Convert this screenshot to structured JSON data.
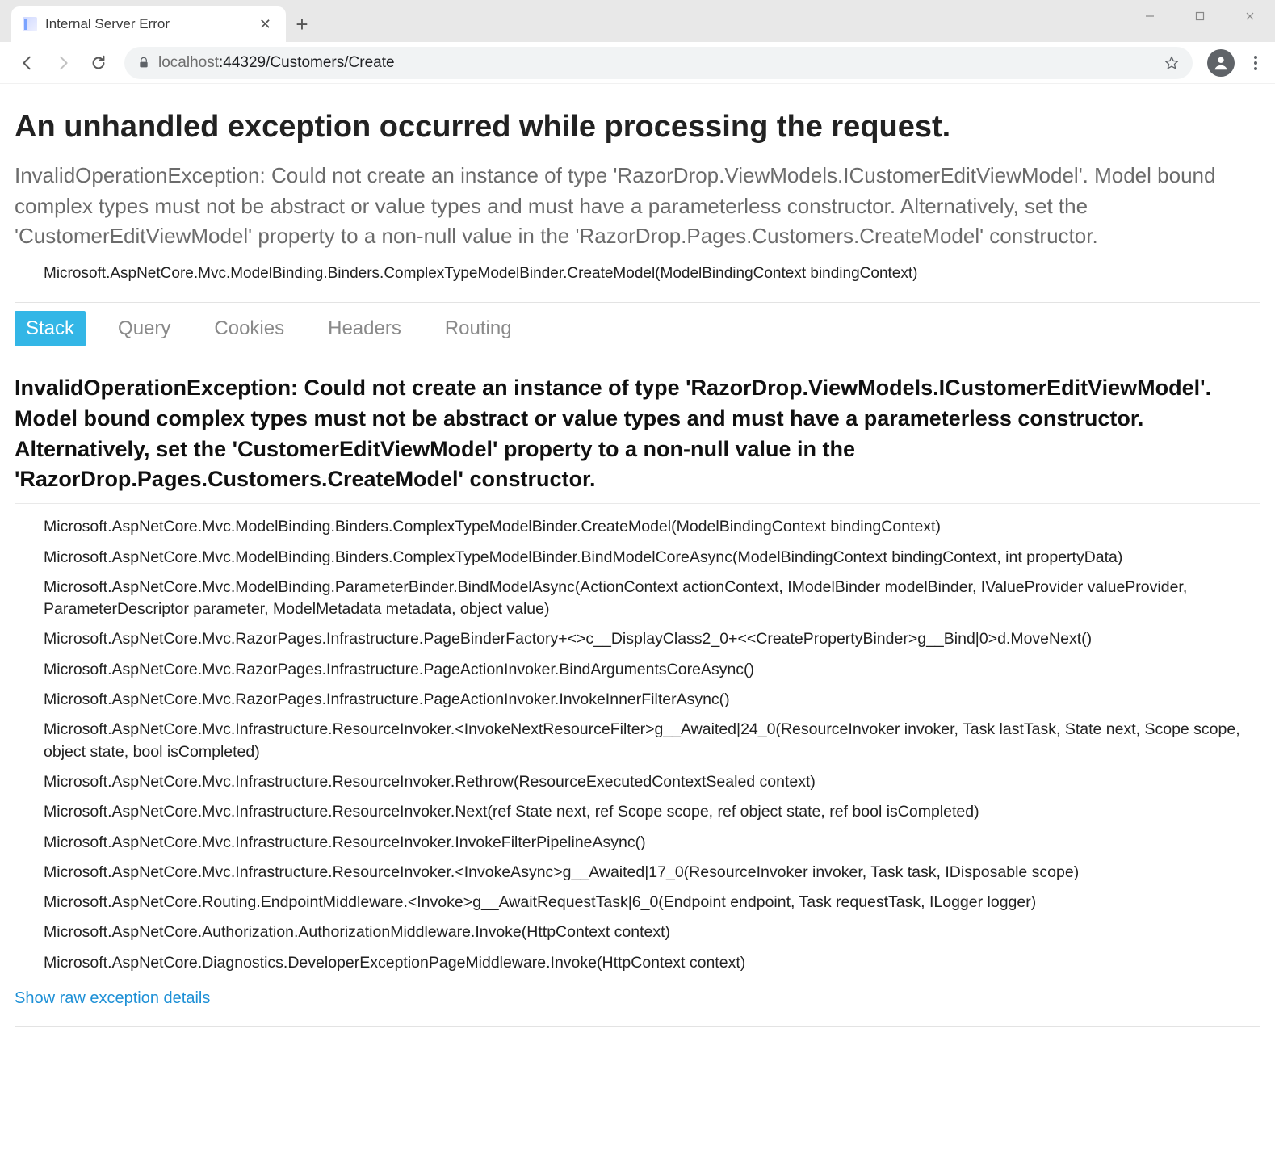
{
  "window": {
    "tab_title": "Internal Server Error",
    "url_host_muted": "localhost",
    "url_port_path": ":44329/Customers/Create"
  },
  "error": {
    "title": "An unhandled exception occurred while processing the request.",
    "summary": "InvalidOperationException: Could not create an instance of type 'RazorDrop.ViewModels.ICustomerEditViewModel'. Model bound complex types must not be abstract or value types and must have a parameterless constructor. Alternatively, set the 'CustomerEditViewModel' property to a non-null value in the 'RazorDrop.Pages.Customers.CreateModel' constructor.",
    "top_frame": "Microsoft.AspNetCore.Mvc.ModelBinding.Binders.ComplexTypeModelBinder.CreateModel(ModelBindingContext bindingContext)"
  },
  "tabs": {
    "stack": "Stack",
    "query": "Query",
    "cookies": "Cookies",
    "headers": "Headers",
    "routing": "Routing"
  },
  "detail": {
    "header": "InvalidOperationException: Could not create an instance of type 'RazorDrop.ViewModels.ICustomerEditViewModel'. Model bound complex types must not be abstract or value types and must have a parameterless constructor. Alternatively, set the 'CustomerEditViewModel' property to a non-null value in the 'RazorDrop.Pages.Customers.CreateModel' constructor.",
    "frames": [
      "Microsoft.AspNetCore.Mvc.ModelBinding.Binders.ComplexTypeModelBinder.CreateModel(ModelBindingContext bindingContext)",
      "Microsoft.AspNetCore.Mvc.ModelBinding.Binders.ComplexTypeModelBinder.BindModelCoreAsync(ModelBindingContext bindingContext, int propertyData)",
      "Microsoft.AspNetCore.Mvc.ModelBinding.ParameterBinder.BindModelAsync(ActionContext actionContext, IModelBinder modelBinder, IValueProvider valueProvider, ParameterDescriptor parameter, ModelMetadata metadata, object value)",
      "Microsoft.AspNetCore.Mvc.RazorPages.Infrastructure.PageBinderFactory+<>c__DisplayClass2_0+<<CreatePropertyBinder>g__Bind|0>d.MoveNext()",
      "Microsoft.AspNetCore.Mvc.RazorPages.Infrastructure.PageActionInvoker.BindArgumentsCoreAsync()",
      "Microsoft.AspNetCore.Mvc.RazorPages.Infrastructure.PageActionInvoker.InvokeInnerFilterAsync()",
      "Microsoft.AspNetCore.Mvc.Infrastructure.ResourceInvoker.<InvokeNextResourceFilter>g__Awaited|24_0(ResourceInvoker invoker, Task lastTask, State next, Scope scope, object state, bool isCompleted)",
      "Microsoft.AspNetCore.Mvc.Infrastructure.ResourceInvoker.Rethrow(ResourceExecutedContextSealed context)",
      "Microsoft.AspNetCore.Mvc.Infrastructure.ResourceInvoker.Next(ref State next, ref Scope scope, ref object state, ref bool isCompleted)",
      "Microsoft.AspNetCore.Mvc.Infrastructure.ResourceInvoker.InvokeFilterPipelineAsync()",
      "Microsoft.AspNetCore.Mvc.Infrastructure.ResourceInvoker.<InvokeAsync>g__Awaited|17_0(ResourceInvoker invoker, Task task, IDisposable scope)",
      "Microsoft.AspNetCore.Routing.EndpointMiddleware.<Invoke>g__AwaitRequestTask|6_0(Endpoint endpoint, Task requestTask, ILogger logger)",
      "Microsoft.AspNetCore.Authorization.AuthorizationMiddleware.Invoke(HttpContext context)",
      "Microsoft.AspNetCore.Diagnostics.DeveloperExceptionPageMiddleware.Invoke(HttpContext context)"
    ]
  },
  "links": {
    "raw": "Show raw exception details"
  }
}
